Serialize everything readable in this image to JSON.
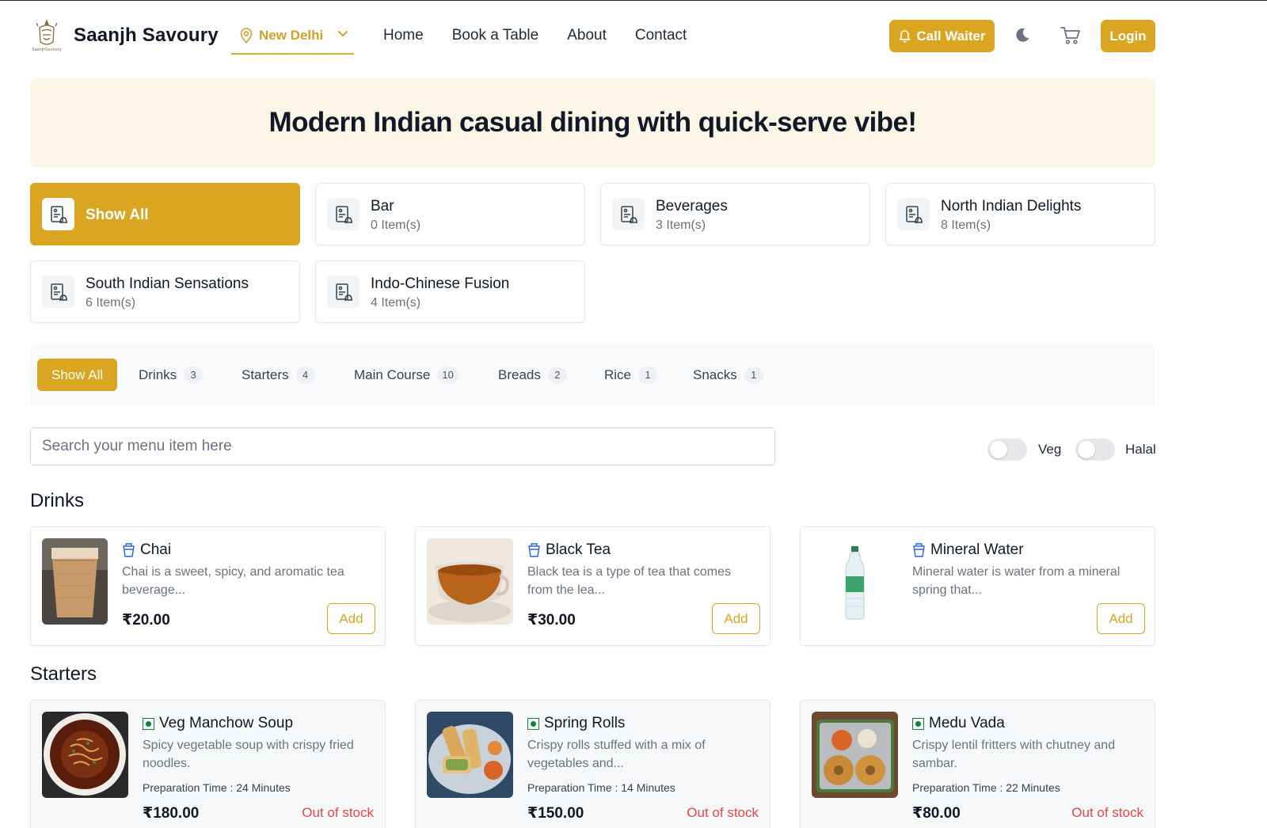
{
  "navbar": {
    "brand": "Saanjh Savoury",
    "logo_text": "SaanjhSavoury",
    "location": "New Delhi",
    "links": [
      "Home",
      "Book a Table",
      "About",
      "Contact"
    ],
    "call_waiter": "Call Waiter",
    "login": "Login",
    "accent_color": "#daa520"
  },
  "hero": {
    "title": "Modern Indian casual dining with quick-serve vibe!"
  },
  "categories": [
    {
      "name": "Show All",
      "count": "",
      "active": true
    },
    {
      "name": "Bar",
      "count": "0 Item(s)"
    },
    {
      "name": "Beverages",
      "count": "3 Item(s)"
    },
    {
      "name": "North Indian Delights",
      "count": "8 Item(s)"
    },
    {
      "name": "South Indian Sensations",
      "count": "6 Item(s)"
    },
    {
      "name": "Indo-Chinese Fusion",
      "count": "4 Item(s)"
    }
  ],
  "tabs": [
    {
      "label": "Show All",
      "active": true
    },
    {
      "label": "Drinks",
      "count": "3"
    },
    {
      "label": "Starters",
      "count": "4"
    },
    {
      "label": "Main Course",
      "count": "10"
    },
    {
      "label": "Breads",
      "count": "2"
    },
    {
      "label": "Rice",
      "count": "1"
    },
    {
      "label": "Snacks",
      "count": "1"
    }
  ],
  "search": {
    "placeholder": "Search your menu item here",
    "value": ""
  },
  "filters": {
    "veg_label": "Veg",
    "halal_label": "Halal",
    "veg_on": false,
    "halal_on": false
  },
  "sections": {
    "drinks": {
      "title": "Drinks",
      "items": [
        {
          "name": "Chai",
          "description": "Chai is a sweet, spicy, and aromatic tea beverage...",
          "price": "₹20.00",
          "action": "Add",
          "icon": "cup-icon"
        },
        {
          "name": "Black Tea",
          "description": "Black tea is a type of tea that comes from the lea...",
          "price": "₹30.00",
          "action": "Add",
          "icon": "cup-icon"
        },
        {
          "name": "Mineral Water",
          "description": "Mineral water is water from a mineral spring that...",
          "price": "",
          "action": "Add",
          "icon": "cup-icon"
        }
      ]
    },
    "starters": {
      "title": "Starters",
      "items": [
        {
          "name": "Veg Manchow Soup",
          "description": "Spicy vegetable soup with crispy fried noodles.",
          "prep": "Preparation Time : 24 Minutes",
          "price": "₹180.00",
          "status": "Out of stock",
          "icon": "veg-mark-icon"
        },
        {
          "name": "Spring Rolls",
          "description": "Crispy rolls stuffed with a mix of vegetables and...",
          "prep": "Preparation Time : 14 Minutes",
          "price": "₹150.00",
          "status": "Out of stock",
          "icon": "veg-mark-icon"
        },
        {
          "name": "Medu Vada",
          "description": "Crispy lentil fritters with chutney and sambar.",
          "prep": "Preparation Time : 22 Minutes",
          "price": "₹80.00",
          "status": "Out of stock",
          "icon": "veg-mark-icon"
        }
      ]
    }
  }
}
